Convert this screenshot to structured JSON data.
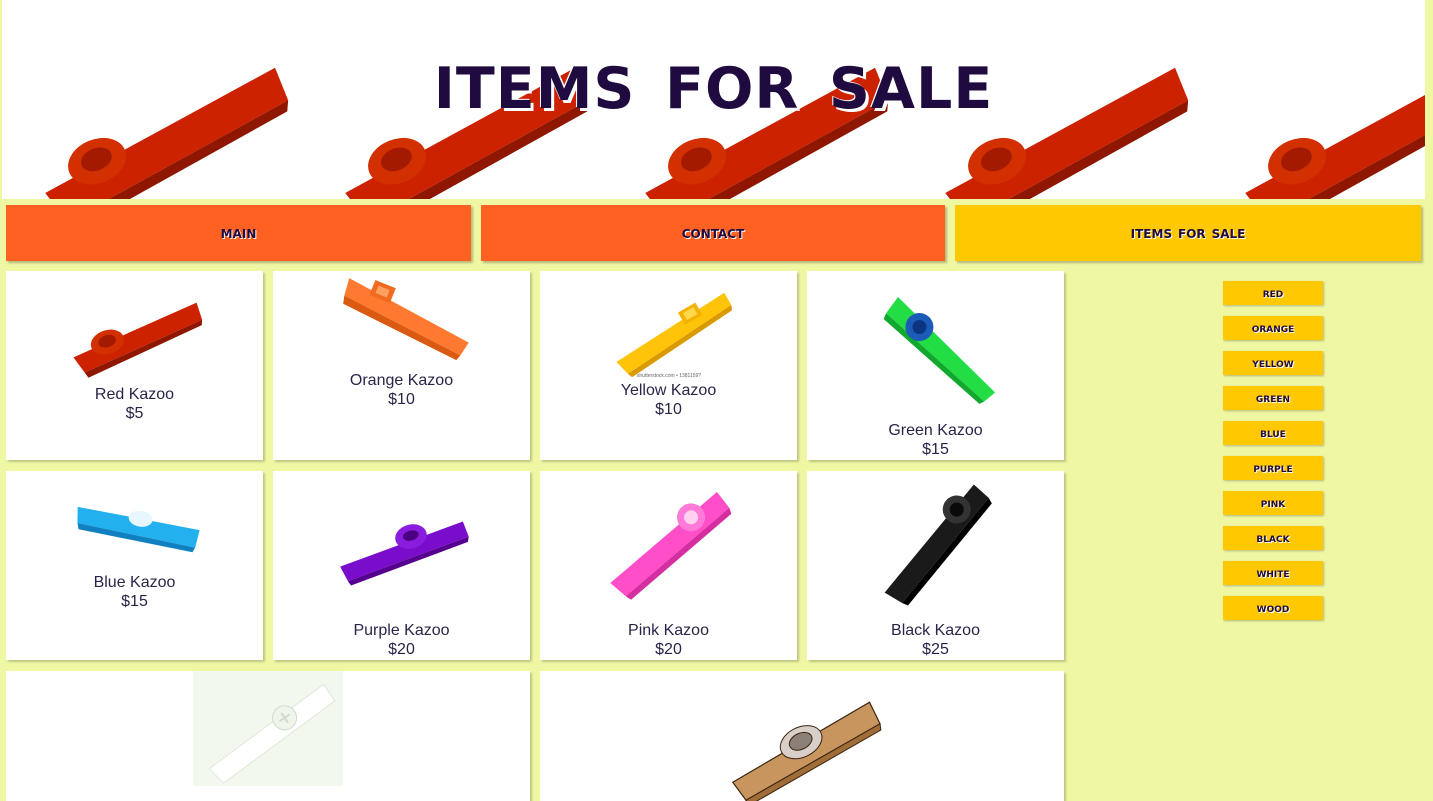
{
  "header": {
    "title": "Items for Sale"
  },
  "nav": [
    {
      "label": "Main",
      "color": "#ff6122"
    },
    {
      "label": "Contact",
      "color": "#ff6122"
    },
    {
      "label": "Items for Sale",
      "color": "#ffc800"
    }
  ],
  "products": [
    {
      "name": "Red Kazoo",
      "price": "$5",
      "color": "#cc2200"
    },
    {
      "name": "Orange Kazoo",
      "price": "$10",
      "color": "#ff7a30"
    },
    {
      "name": "Yellow Kazoo",
      "price": "$10",
      "color": "#ffc40a"
    },
    {
      "name": "Green Kazoo",
      "price": "$15",
      "color": "#22dd44"
    },
    {
      "name": "Blue Kazoo",
      "price": "$15",
      "color": "#22b0ee"
    },
    {
      "name": "Purple Kazoo",
      "price": "$20",
      "color": "#7a0ccc"
    },
    {
      "name": "Pink Kazoo",
      "price": "$20",
      "color": "#ff4ec8"
    },
    {
      "name": "Black Kazoo",
      "price": "$25",
      "color": "#1a1a1a"
    },
    {
      "name": "",
      "price": "",
      "color": "#f2f8ee"
    },
    {
      "name": "",
      "price": "",
      "color": "#c8955e"
    }
  ],
  "image_caption": "shutterstock.com • 1381159?",
  "filters": [
    "Red",
    "Orange",
    "Yellow",
    "Green",
    "Blue",
    "Purple",
    "Pink",
    "Black",
    "White",
    "Wood"
  ],
  "colors": {
    "background": "#eff7a3",
    "text": "#1f0b3f",
    "banner_kazoo": "#cc2200"
  }
}
